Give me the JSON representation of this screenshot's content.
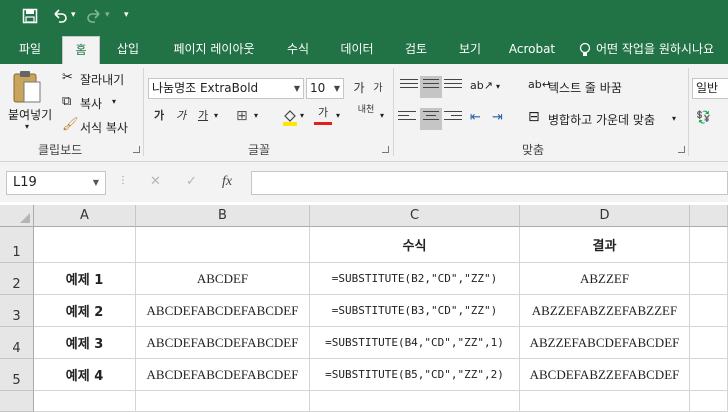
{
  "quick_access": {
    "save_icon": "save-icon",
    "undo_icon": "undo-icon",
    "redo_icon": "redo-icon",
    "customize_icon": "customize-icon"
  },
  "tabs": [
    "파일",
    "홈",
    "삽입",
    "페이지 레이아웃",
    "수식",
    "데이터",
    "검토",
    "보기",
    "Acrobat"
  ],
  "tell_me": "어떤 작업을 원하시나요",
  "clipboard": {
    "paste": "붙여넣기",
    "cut": "잘라내기",
    "copy": "복사",
    "format_painter": "서식 복사",
    "group": "클립보드"
  },
  "font": {
    "name": "나눔명조 ExtraBold",
    "size": "10",
    "group": "글꼴",
    "bold": "가",
    "italic": "가",
    "underline": "가",
    "grow": "가",
    "shrink": "가",
    "color_letter": "가",
    "phonetic": "내천"
  },
  "alignment": {
    "wrap_text": "텍스트 줄 바꿈",
    "merge_center": "병합하고 가운데 맞춤",
    "group": "맞춤"
  },
  "number": {
    "format": "일반"
  },
  "formula_bar": {
    "name_box": "L19",
    "cancel": "✕",
    "enter": "✓",
    "fx": "fx",
    "formula": ""
  },
  "sheet": {
    "columns": [
      "A",
      "B",
      "C",
      "D"
    ],
    "rows": [
      "1",
      "2",
      "3",
      "4",
      "5"
    ],
    "header_row": {
      "a": "",
      "b": "",
      "c": "수식",
      "d": "결과"
    },
    "data": [
      {
        "a": "예제 1",
        "b": "ABCDEF",
        "c": "=SUBSTITUTE(B2,\"CD\",\"ZZ\")",
        "d": "ABZZEF"
      },
      {
        "a": "예제 2",
        "b": "ABCDEFABCDEFABCDEF",
        "c": "=SUBSTITUTE(B3,\"CD\",\"ZZ\")",
        "d": "ABZZEFABZZEFABZZEF"
      },
      {
        "a": "예제 3",
        "b": "ABCDEFABCDEFABCDEF",
        "c": "=SUBSTITUTE(B4,\"CD\",\"ZZ\",1)",
        "d": "ABZZEFABCDEFABCDEF"
      },
      {
        "a": "예제 4",
        "b": "ABCDEFABCDEFABCDEF",
        "c": "=SUBSTITUTE(B5,\"CD\",\"ZZ\",2)",
        "d": "ABCDEFABZZEFABCDEF"
      }
    ]
  },
  "colors": {
    "excel_green": "#217346",
    "ribbon_bg": "#f3f3f3",
    "header_bg": "#e6e6e6"
  }
}
